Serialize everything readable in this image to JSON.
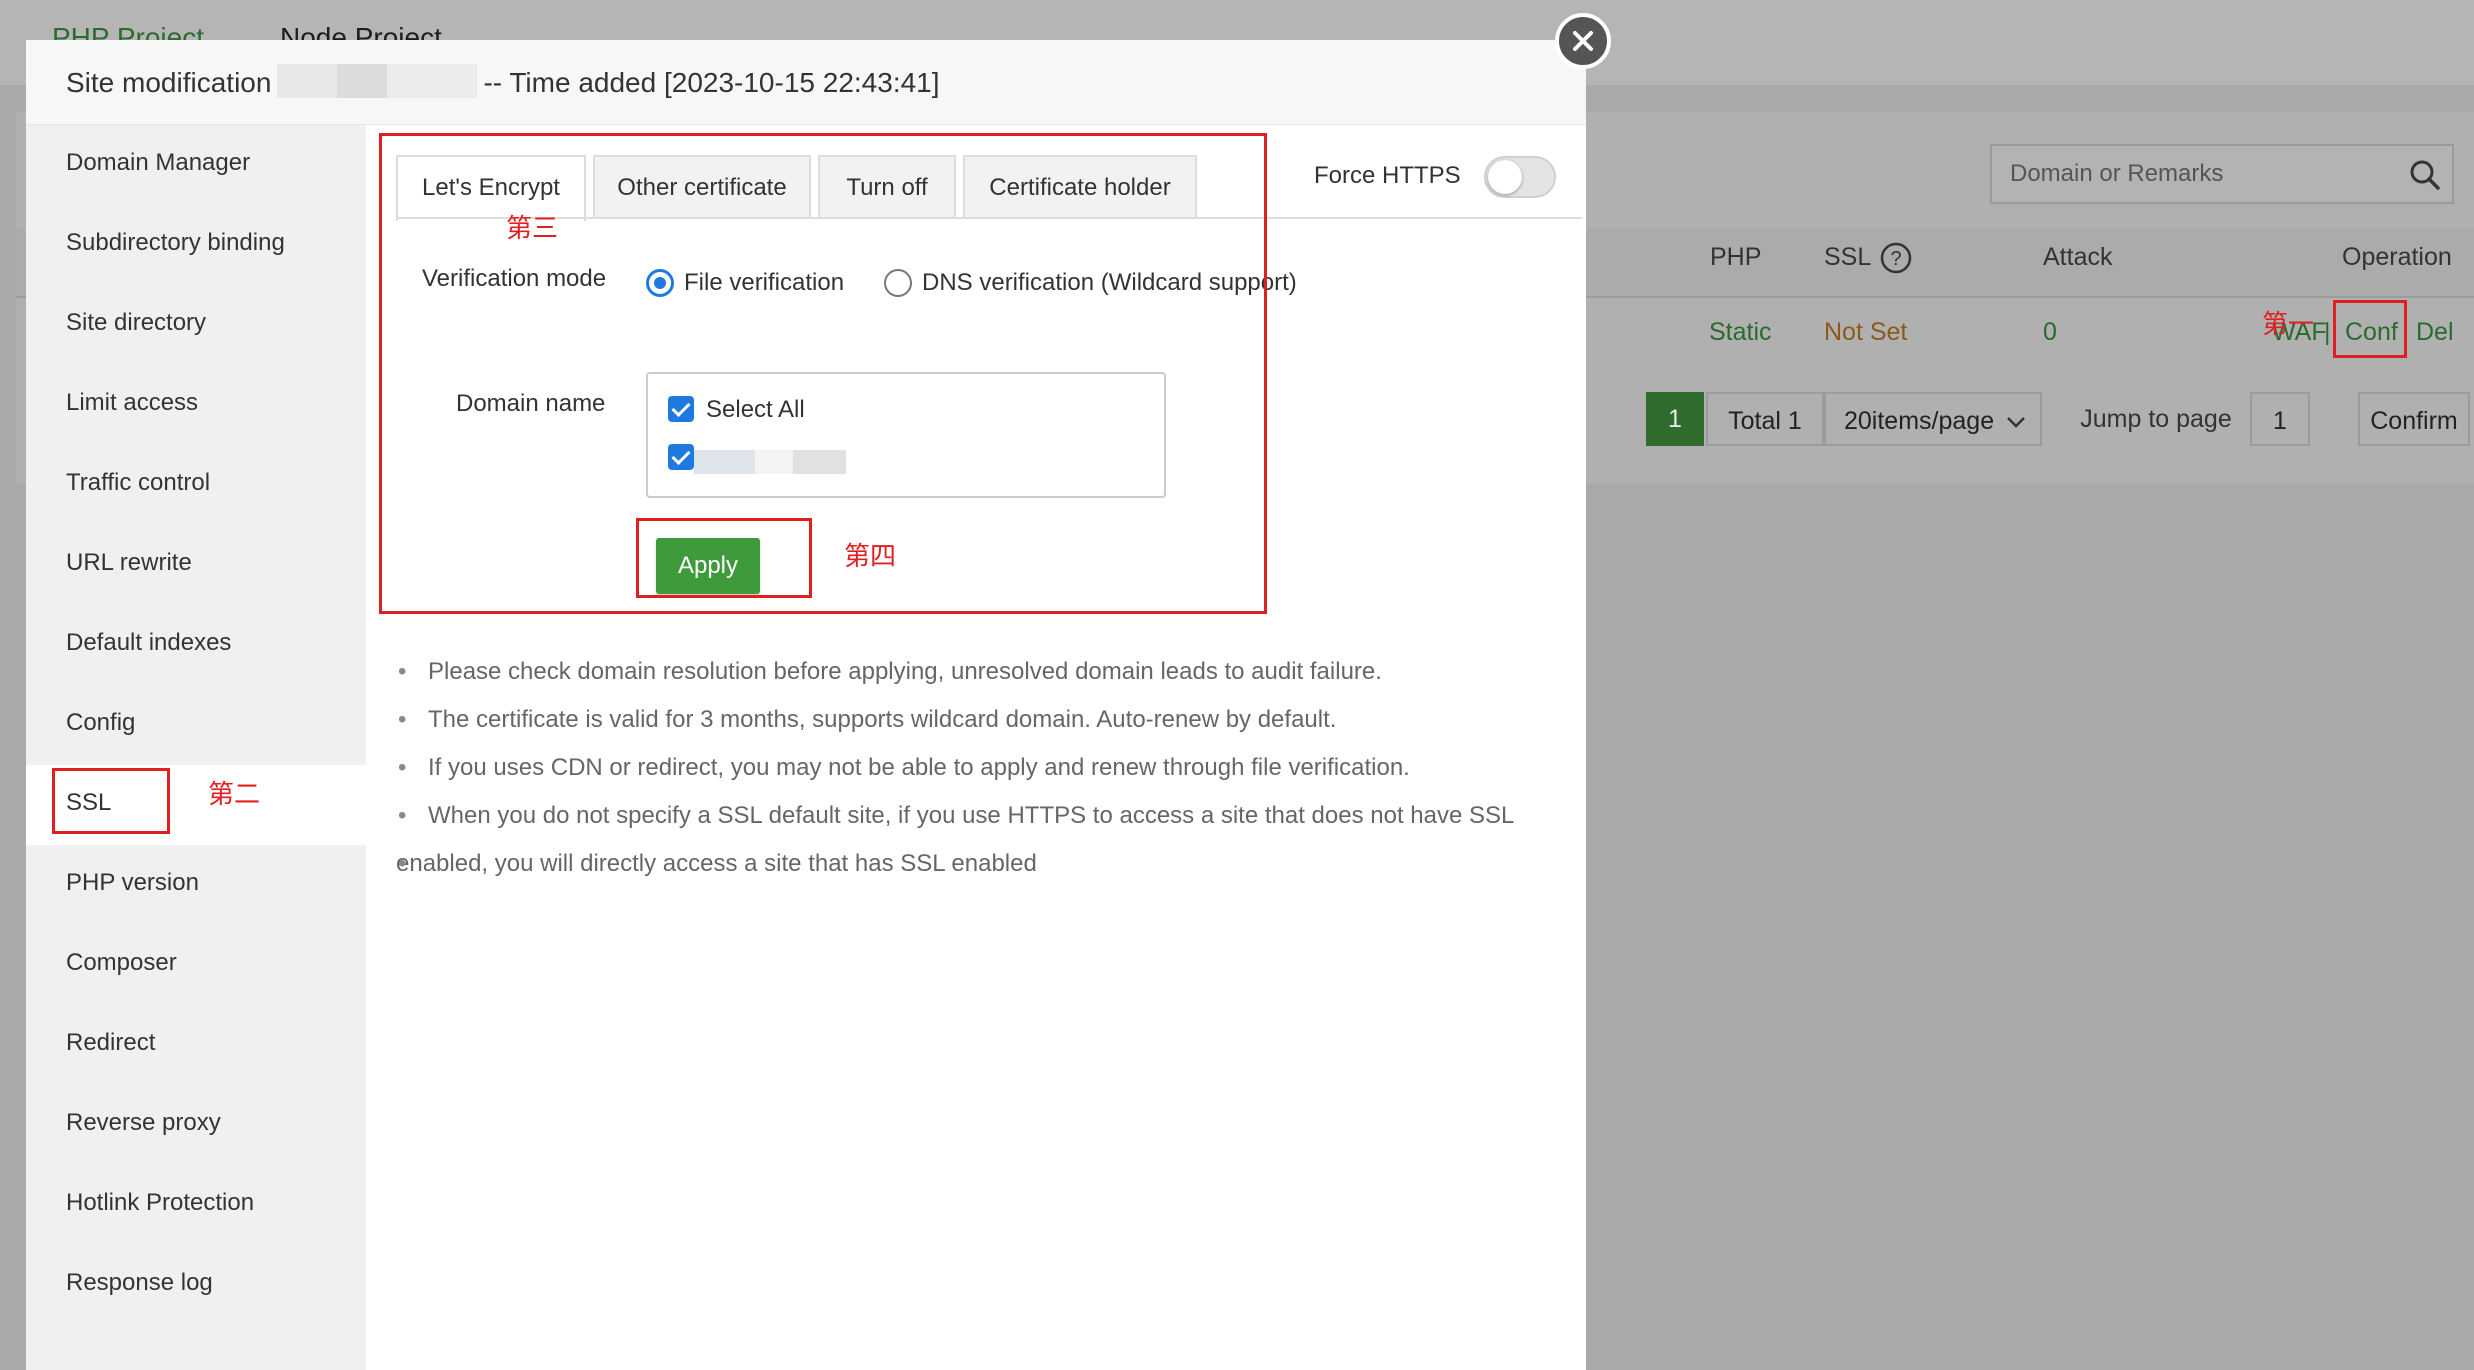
{
  "background": {
    "tabs": [
      "PHP Project",
      "Node Project"
    ],
    "search_placeholder": "Domain or Remarks",
    "columns": [
      "PHP",
      "SSL",
      "Attack",
      "Operation"
    ],
    "row": {
      "php": "Static",
      "ssl": "Not Set",
      "attack": "0",
      "waf": "WAF",
      "conf": "Conf",
      "del": "Del",
      "sep": "|"
    },
    "pagination": {
      "current": "1",
      "total": "Total 1",
      "per_page": "20items/page",
      "jump_label": "Jump to page",
      "jump_value": "1",
      "confirm": "Confirm"
    },
    "annotation_first": "第一"
  },
  "modal": {
    "title_prefix": "Site modification",
    "title_suffix": "-- Time added [2023-10-15 22:43:41]",
    "sidebar": [
      "Domain Manager",
      "Subdirectory binding",
      "Site directory",
      "Limit access",
      "Traffic control",
      "URL rewrite",
      "Default indexes",
      "Config",
      "SSL",
      "PHP version",
      "Composer",
      "Redirect",
      "Reverse proxy",
      "Hotlink Protection",
      "Response log"
    ],
    "annotation_second": "第二",
    "tabs": [
      "Let's Encrypt",
      "Other certificate",
      "Turn off",
      "Certificate holder"
    ],
    "annotation_third": "第三",
    "force_https_label": "Force HTTPS",
    "verification_label": "Verification mode",
    "verification_options": [
      "File verification",
      "DNS verification (Wildcard support)"
    ],
    "domain_label": "Domain name",
    "select_all": "Select All",
    "apply": "Apply",
    "annotation_fourth": "第四",
    "tips": [
      "Please check domain resolution before applying, unresolved domain leads to audit failure.",
      "The certificate is valid for 3 months, supports wildcard domain. Auto-renew by default.",
      "If you uses CDN or redirect, you may not be able to apply and renew through file verification.",
      "When you do not specify a SSL default site, if you use HTTPS to access a site that does not have SSL",
      "enabled, you will directly access a site that has SSL enabled"
    ]
  },
  "colors": {
    "accent_green": "#3f9a3c",
    "annotation_red": "#e02020",
    "checkbox_blue": "#1e7ae0"
  }
}
